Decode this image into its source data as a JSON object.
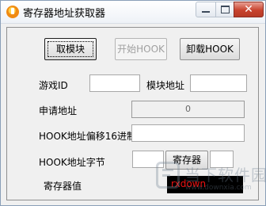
{
  "window": {
    "title": "寄存器地址获取器",
    "close_glyph": "✕"
  },
  "buttons": {
    "get_module": "取模块",
    "start_hook": "开始HOOK",
    "unload_hook": "卸载HOOK",
    "register": "寄存器"
  },
  "labels": {
    "game_id": "游戏ID",
    "module_address": "模块地址",
    "apply_address": "申请地址",
    "hook_offset_hex": "HOOK地址偏移16进制",
    "hook_bytes": "HOOK地址字节",
    "register_value": "寄存器值"
  },
  "fields": {
    "game_id": "",
    "module_address": "",
    "apply_address": "0",
    "hook_offset": "",
    "hook_bytes": "",
    "register_field": "",
    "register_value_display": "rxdown"
  },
  "watermark": {
    "text": "当下软件园",
    "sub": "www.downxia.com"
  },
  "colors": {
    "close_button": "#c8432e",
    "register_value_text": "#ee1111",
    "register_value_bg": "#000000"
  }
}
